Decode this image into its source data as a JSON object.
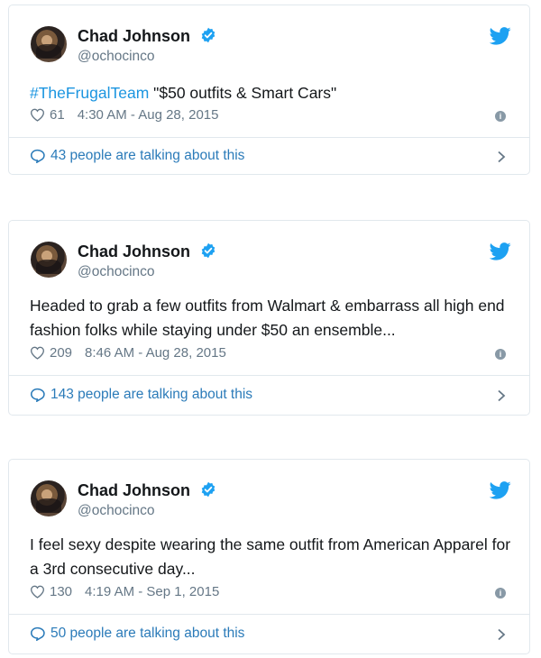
{
  "tweets": [
    {
      "name": "Chad Johnson",
      "handle": "@ochocinco",
      "hashtag": "#TheFrugalTeam",
      "text": " \"$50 outfits & Smart Cars\"",
      "likes": "61",
      "timestamp": "4:30 AM - Aug 28, 2015",
      "talking": "43 people are talking about this"
    },
    {
      "name": "Chad Johnson",
      "handle": "@ochocinco",
      "hashtag": "",
      "text": "Headed to grab a few outfits from Walmart & embarrass all high end fashion folks while staying under $50 an ensemble...",
      "likes": "209",
      "timestamp": "8:46 AM - Aug 28, 2015",
      "talking": "143 people are talking about this"
    },
    {
      "name": "Chad Johnson",
      "handle": "@ochocinco",
      "hashtag": "",
      "text": "I feel sexy despite wearing the same outfit from American Apparel for a 3rd consecutive day...",
      "likes": "130",
      "timestamp": "4:19 AM - Sep 1, 2015",
      "talking": "50 people are talking about this"
    }
  ],
  "icons": {
    "verified": "verified-badge-icon",
    "bird": "twitter-bird-icon",
    "like": "heart-icon",
    "info": "info-icon",
    "reply": "speech-bubble-icon",
    "more": "chevron-right-icon"
  },
  "colors": {
    "link": "#1b95e0",
    "talk": "#2b7bb9",
    "muted": "#657786",
    "border": "#e1e8ed"
  }
}
